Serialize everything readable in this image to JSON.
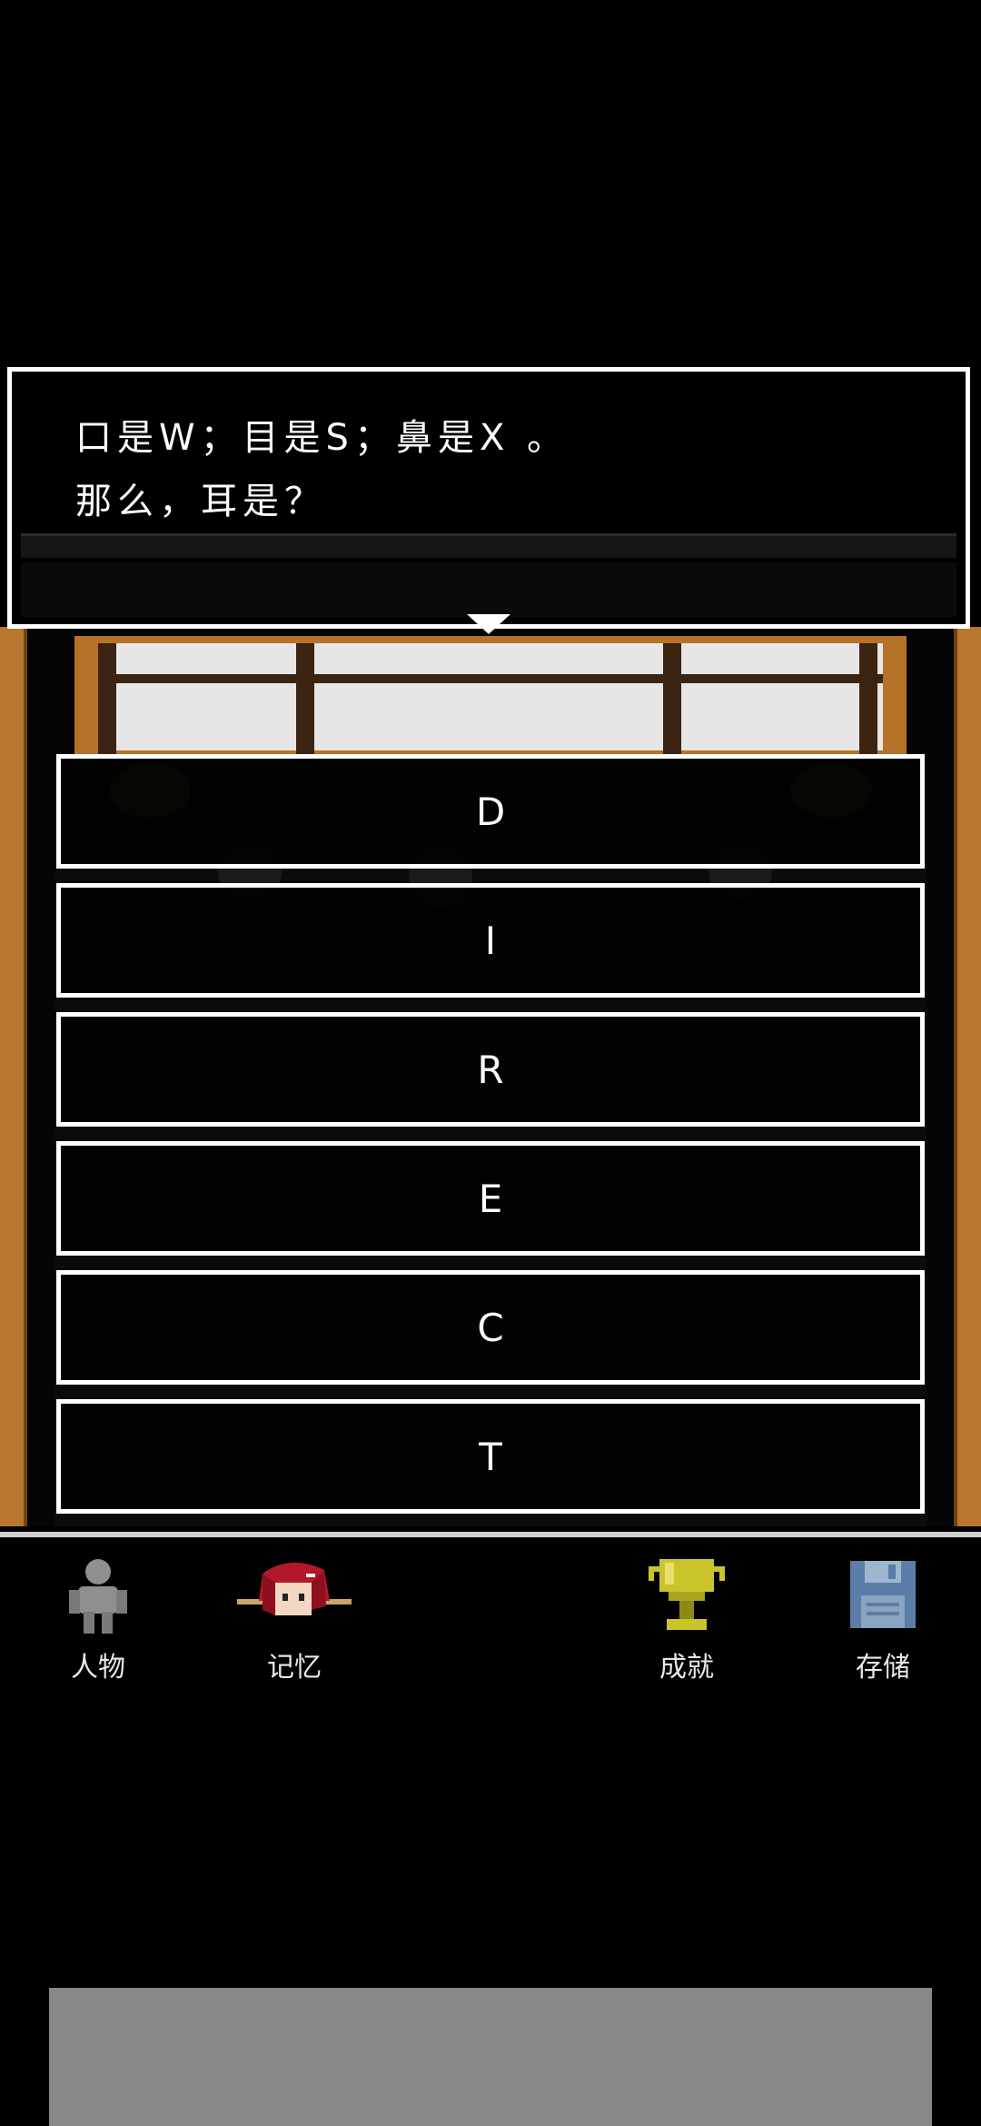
{
  "dialog": {
    "line1": "口是W；目是S；鼻是X 。",
    "line2": "那么，耳是？"
  },
  "options": [
    "D",
    "I",
    "R",
    "E",
    "C",
    "T"
  ],
  "nav": {
    "characters": "人物",
    "memory": "记忆",
    "achievements": "成就",
    "save": "存储"
  },
  "colors": {
    "pillar": "#b8762f",
    "trophy": "#c9c42a",
    "save_icon": "#5b7ea8",
    "ad_banner": "#888888"
  }
}
